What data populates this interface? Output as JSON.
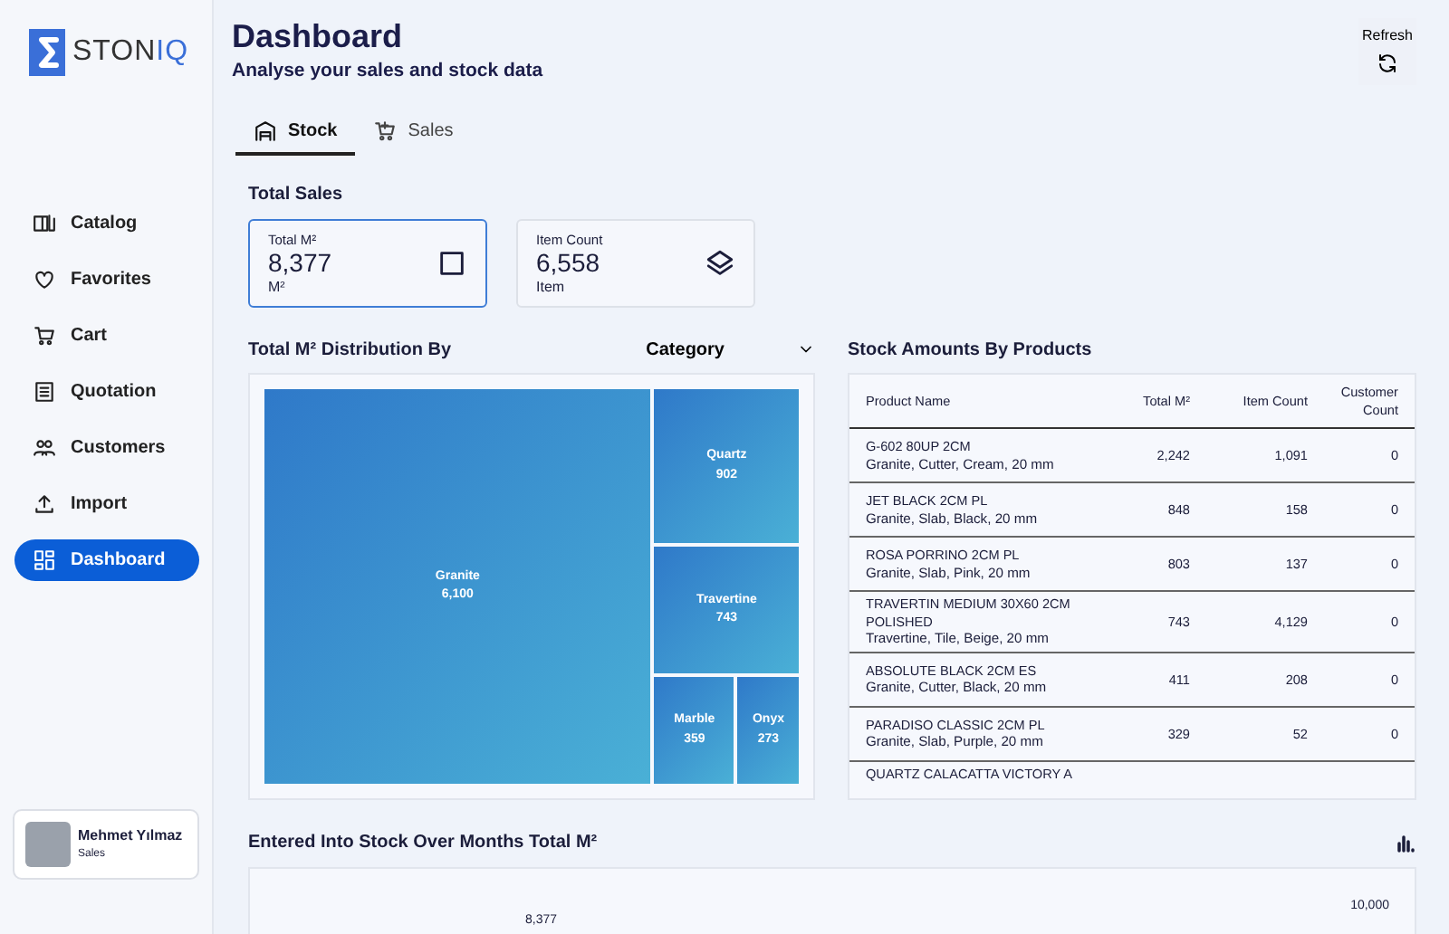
{
  "logo": {
    "text": "STON",
    "accent": "IQ"
  },
  "sidebar": {
    "items": [
      {
        "label": "Catalog",
        "selected": false
      },
      {
        "label": "Favorites",
        "selected": false
      },
      {
        "label": "Cart",
        "selected": false
      },
      {
        "label": "Quotation",
        "selected": false
      },
      {
        "label": "Customers",
        "selected": false
      },
      {
        "label": "Import",
        "selected": false
      },
      {
        "label": "Dashboard",
        "selected": true
      }
    ]
  },
  "user": {
    "name": "Mehmet Yılmaz",
    "role": "Sales"
  },
  "header": {
    "title": "Dashboard",
    "subtitle": "Analyse your sales and stock data",
    "refresh_label": "Refresh"
  },
  "tabs": [
    {
      "label": "Stock",
      "selected": true
    },
    {
      "label": "Sales",
      "selected": false
    }
  ],
  "total_sales": {
    "title": "Total Sales",
    "cards": [
      {
        "title": "Total M²",
        "value": "8,377",
        "unit": "M²",
        "selected": true
      },
      {
        "title": "Item Count",
        "value": "6,558",
        "unit": "Item",
        "selected": false
      }
    ]
  },
  "distribution": {
    "title": "Total M² Distribution By",
    "group_by": "Category",
    "tiles": [
      {
        "label": "Granite",
        "value": "6,100"
      },
      {
        "label": "Quartz",
        "value": "902"
      },
      {
        "label": "Travertine",
        "value": "743"
      },
      {
        "label": "Marble",
        "value": "359"
      },
      {
        "label": "Onyx",
        "value": "273"
      }
    ]
  },
  "stock_table": {
    "title": "Stock Amounts By Products",
    "columns": [
      "Product Name",
      "Total M²",
      "Item Count",
      "Customer Count"
    ],
    "rows": [
      {
        "name": "G-602 80UP 2CM",
        "detail": "Granite, Cutter, Cream, 20 mm",
        "total": "2,242",
        "items": "1,091",
        "customers": "0"
      },
      {
        "name": "JET BLACK 2CM PL",
        "detail": "Granite, Slab, Black, 20 mm",
        "total": "848",
        "items": "158",
        "customers": "0"
      },
      {
        "name": "ROSA PORRINO 2CM PL",
        "detail": "Granite, Slab, Pink, 20 mm",
        "total": "803",
        "items": "137",
        "customers": "0"
      },
      {
        "name": "TRAVERTIN MEDIUM 30X60 2CM POLISHED",
        "detail": "Travertine, Tile, Beige, 20 mm",
        "total": "743",
        "items": "4,129",
        "customers": "0"
      },
      {
        "name": "ABSOLUTE BLACK 2CM ES",
        "detail": "Granite, Cutter, Black, 20 mm",
        "total": "411",
        "items": "208",
        "customers": "0"
      },
      {
        "name": "PARADISO CLASSIC 2CM PL",
        "detail": "Granite, Slab, Purple, 20 mm",
        "total": "329",
        "items": "52",
        "customers": "0"
      },
      {
        "name": "QUARTZ CALACATTA VICTORY A"
      }
    ]
  },
  "monthly": {
    "title": "Entered Into Stock Over Months Total M²",
    "tick": "10,000",
    "bar_label": "8,377"
  }
}
